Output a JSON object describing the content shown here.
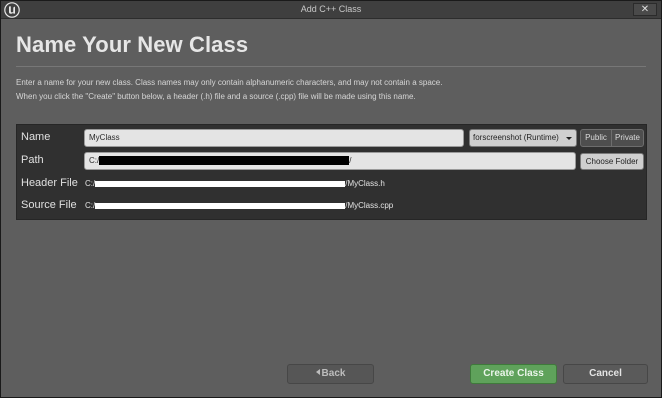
{
  "window": {
    "title": "Add C++ Class",
    "close_label": "✕",
    "logo_icon": "unreal-logo"
  },
  "page": {
    "heading": "Name Your New Class",
    "description_line1": "Enter a name for your new class. Class names may only contain alphanumeric characters, and may not contain a space.",
    "description_line2": "When you click the \"Create\" button below, a header (.h) file and a source (.cpp) file will be made using this name."
  },
  "form": {
    "name_label": "Name",
    "name_value": "MyClass",
    "module_value": "forscreenshot (Runtime)",
    "public_label": "Public",
    "private_label": "Private",
    "path_label": "Path",
    "path_prefix": "C:/",
    "path_suffix": "/",
    "choose_folder_label": "Choose Folder",
    "header_label": "Header File",
    "header_prefix": "C:/",
    "header_suffix": "/MyClass.h",
    "source_label": "Source File",
    "source_prefix": "C:/",
    "source_suffix": "/MyClass.cpp"
  },
  "buttons": {
    "back_label": "Back",
    "create_label": "Create Class",
    "cancel_label": "Cancel"
  },
  "colors": {
    "create_accent": "#5fa25b",
    "background": "#5e5e5e",
    "panel": "#303030"
  }
}
